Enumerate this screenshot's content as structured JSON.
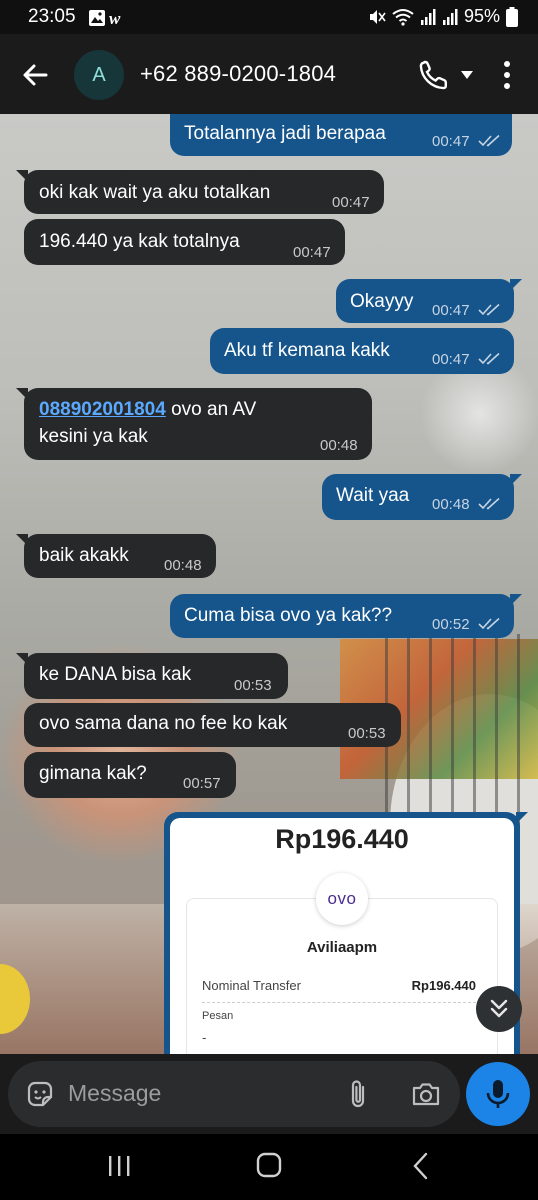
{
  "status_bar": {
    "time": "23:05",
    "battery": "95%",
    "icons": [
      "gallery-icon",
      "w-app-icon",
      "mute-icon",
      "wifi-icon",
      "signal-icon",
      "signal-icon",
      "battery-icon"
    ]
  },
  "header": {
    "avatar_letter": "A",
    "contact": "+62 889-0200-1804",
    "icons": [
      "back-arrow-icon",
      "phone-icon",
      "dropdown-icon",
      "more-vert-icon"
    ]
  },
  "messages": [
    {
      "dir": "out",
      "text": "Totalannya jadi berapaa",
      "time": "00:47",
      "read": true
    },
    {
      "dir": "in",
      "text": "oki kak wait ya aku totalkan",
      "time": "00:47"
    },
    {
      "dir": "in",
      "text": "196.440 ya kak totalnya",
      "time": "00:47"
    },
    {
      "dir": "out",
      "text": "Okayyy",
      "time": "00:47",
      "read": true
    },
    {
      "dir": "out",
      "text": "Aku tf kemana kakk",
      "time": "00:47",
      "read": true
    },
    {
      "dir": "in",
      "link": "088902001804",
      "text": " ovo an AV",
      "text2": "kesini ya kak",
      "time": "00:48"
    },
    {
      "dir": "out",
      "text": "Wait yaa",
      "time": "00:48",
      "read": true
    },
    {
      "dir": "in",
      "text": "baik akakk",
      "time": "00:48"
    },
    {
      "dir": "out",
      "text": "Cuma bisa ovo ya kak??",
      "time": "00:52",
      "read": true
    },
    {
      "dir": "in",
      "text": "ke DANA bisa kak",
      "time": "00:53"
    },
    {
      "dir": "in",
      "text": "ovo sama dana no fee ko kak",
      "time": "00:53"
    },
    {
      "dir": "in",
      "text": "gimana kak?",
      "time": "00:57"
    }
  ],
  "receipt": {
    "amount": "Rp196.440",
    "logo": "ovo",
    "name": "Aviliaapm",
    "nominal_label": "Nominal Transfer",
    "nominal_value": "Rp196.440",
    "pesan_label": "Pesan",
    "pesan_value": "-"
  },
  "compose": {
    "placeholder": "Message",
    "icons": [
      "emoji-sticker-icon",
      "attach-icon",
      "camera-icon",
      "mic-icon"
    ]
  },
  "nav": {
    "icons": [
      "recent-apps-icon",
      "home-icon",
      "back-icon"
    ]
  },
  "colors": {
    "incoming": "#262829",
    "outgoing": "#15558c",
    "mic": "#1b84e6",
    "link": "#5aa9ff"
  }
}
